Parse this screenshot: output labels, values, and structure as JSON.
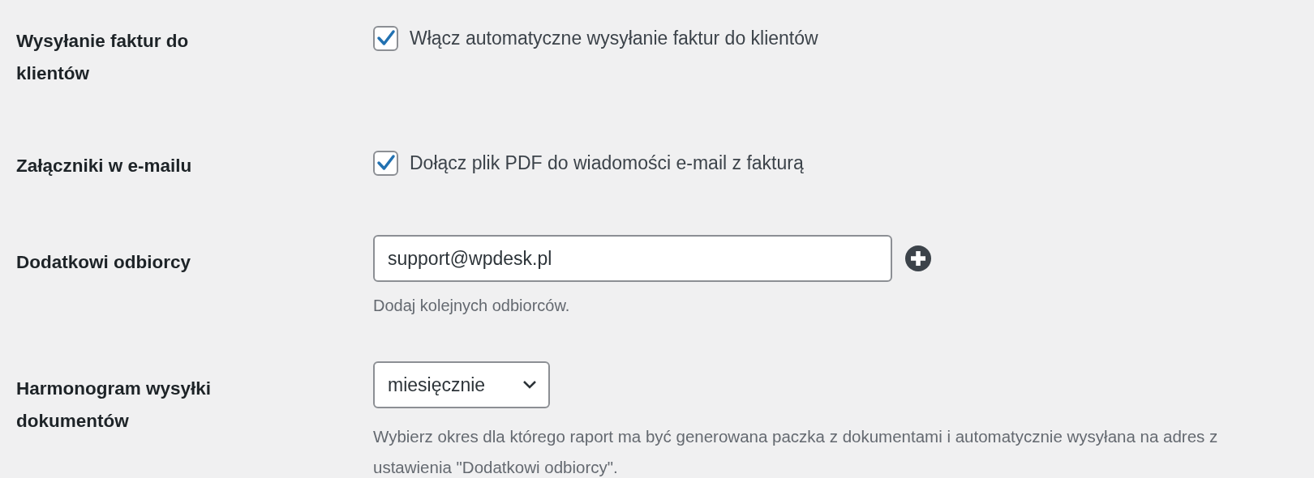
{
  "settings": [
    {
      "kind": "checkbox",
      "label": "Wysyłanie faktur do klientów",
      "option": "Włącz automatyczne wysyłanie faktur do klientów",
      "checked": true
    },
    {
      "kind": "checkbox",
      "label": "Załączniki w e-mailu",
      "option": "Dołącz plik PDF do wiadomości e-mail z fakturą",
      "checked": true
    },
    {
      "kind": "text",
      "label": "Dodatkowi odbiorcy",
      "value": "support@wpdesk.pl",
      "description": "Dodaj kolejnych odbiorców."
    },
    {
      "kind": "select",
      "label": "Harmonogram wysyłki dokumentów",
      "value": "miesięcznie",
      "description": "Wybierz okres dla którego raport ma być generowana paczka z dokumentami i automatycznie wysyłana na adres z ustawienia \"Dodatkowi odbiorcy\"."
    }
  ]
}
